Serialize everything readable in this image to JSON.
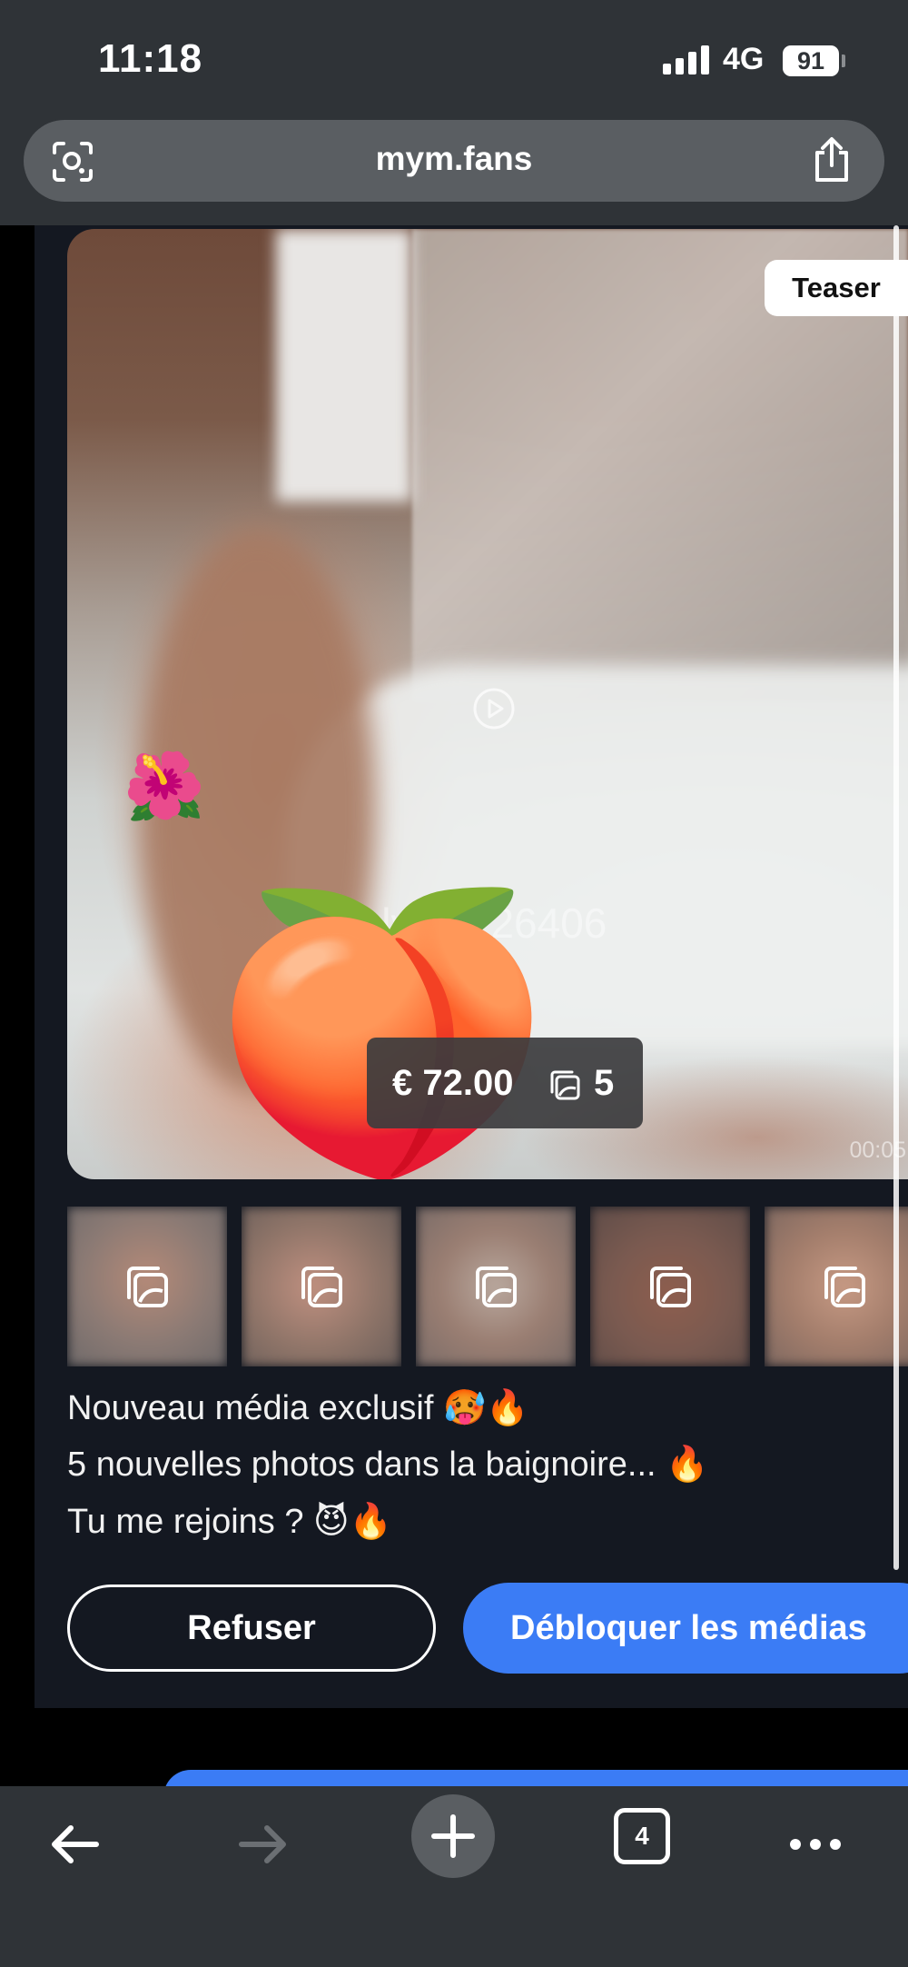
{
  "status_bar": {
    "time": "11:18",
    "network": "4G",
    "battery": "91"
  },
  "browser": {
    "url": "mym.fans",
    "open_tabs": "4"
  },
  "post": {
    "badge": "Teaser",
    "price": "€ 72.00",
    "media_count": "5",
    "duration": "00:05",
    "watermark_line1": "Kalvin2126406",
    "watermark_line2": "2126406",
    "emoji_flower": "🌺",
    "emoji_peach": "🍑",
    "caption_lines": [
      "Nouveau média exclusif 🥵🔥",
      "5 nouvelles photos dans la baignoire... 🔥",
      "Tu me rejoins ? 😈🔥"
    ],
    "thumbnail_count": 5
  },
  "actions": {
    "refuse_label": "Refuser",
    "unlock_label": "Débloquer les médias"
  },
  "colors": {
    "accent": "#3b7cf5",
    "chrome": "#2f3337",
    "card": "#141821"
  }
}
